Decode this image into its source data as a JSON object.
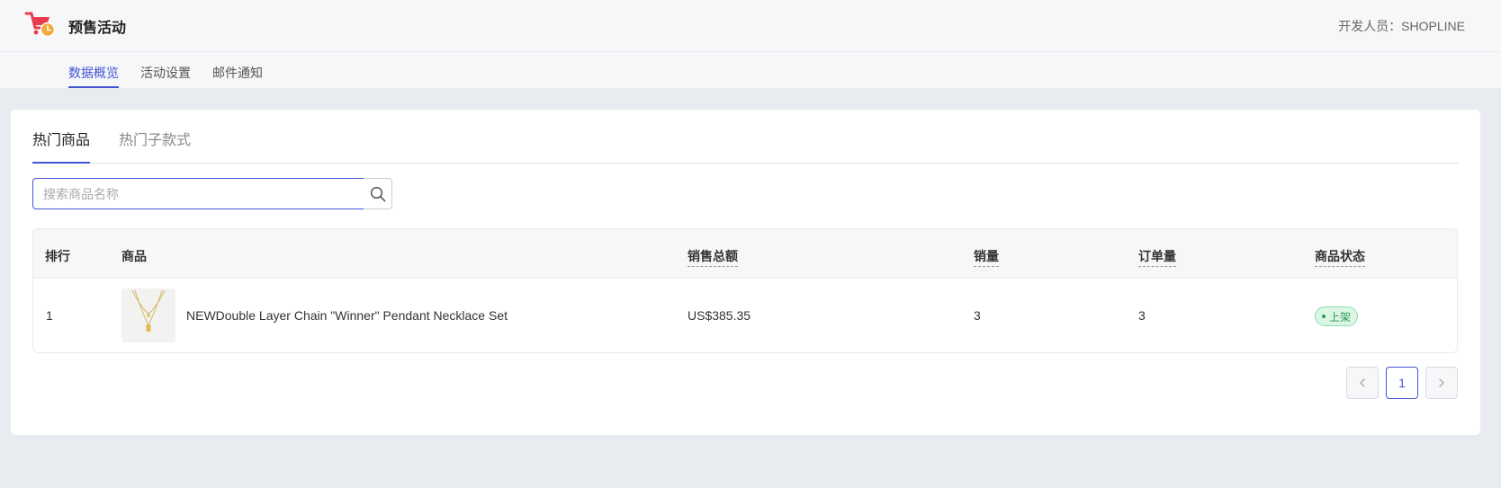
{
  "header": {
    "app_title": "预售活动",
    "developer": "开发人员：SHOPLINE",
    "logo_icon": "shopping-cart-clock-icon",
    "brand_color": "#ea3b4c",
    "accent_color": "#4255d4"
  },
  "nav": {
    "tabs": [
      {
        "label": "数据概览",
        "active": true
      },
      {
        "label": "活动设置",
        "active": false
      },
      {
        "label": "邮件通知",
        "active": false
      }
    ]
  },
  "content": {
    "tabs": [
      {
        "label": "热门商品",
        "active": true
      },
      {
        "label": "热门子款式",
        "active": false
      }
    ],
    "search": {
      "placeholder": "搜索商品名称",
      "value": "",
      "icon": "search-icon"
    },
    "table": {
      "columns": [
        "排行",
        "商品",
        "销售总额",
        "销量",
        "订单量",
        "商品状态"
      ],
      "rows": [
        {
          "rank": "1",
          "product_name": "NEWDouble Layer Chain \"Winner\" Pendant Necklace Set",
          "sales_total": "US$385.35",
          "sales_volume": "3",
          "order_count": "3",
          "status": "上架",
          "status_color": "#2c9c5a"
        }
      ]
    },
    "pagination": {
      "prev_icon": "chevron-left-icon",
      "next_icon": "chevron-right-icon",
      "current_page": "1"
    }
  }
}
